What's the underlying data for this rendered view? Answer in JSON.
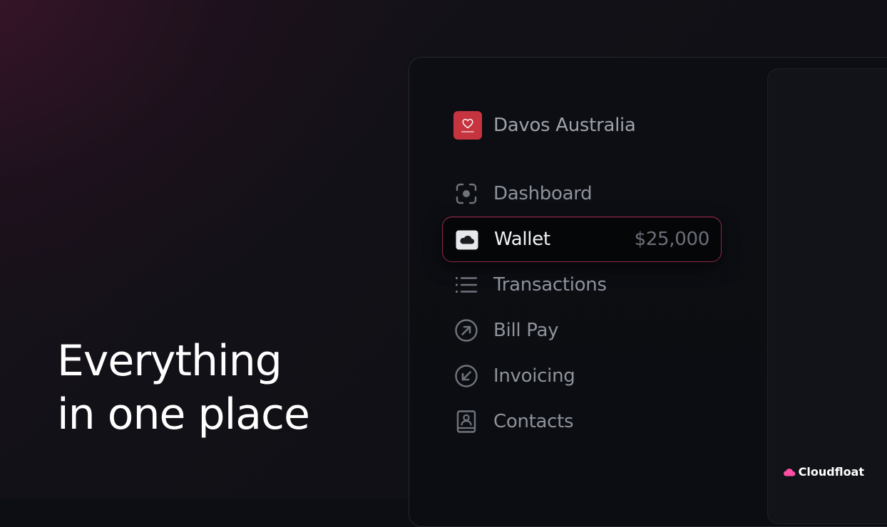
{
  "headline": {
    "line1": "Everything",
    "line2": "in one place"
  },
  "org": {
    "name": "Davos Australia",
    "logo_color": "#c5343f"
  },
  "nav": {
    "items": [
      {
        "label": "Dashboard",
        "icon": "dashboard-focus-icon",
        "active": false
      },
      {
        "label": "Wallet",
        "icon": "cloud-wallet-icon",
        "active": true,
        "amount": "$25,000"
      },
      {
        "label": "Transactions",
        "icon": "list-icon",
        "active": false
      },
      {
        "label": "Bill Pay",
        "icon": "arrow-up-right-circle-icon",
        "active": false
      },
      {
        "label": "Invoicing",
        "icon": "arrow-down-left-circle-icon",
        "active": false
      },
      {
        "label": "Contacts",
        "icon": "contact-book-icon",
        "active": false
      }
    ]
  },
  "brand": {
    "name": "Cloudfloat",
    "accent": "#ff4fa3"
  },
  "colors": {
    "active_border": "#8b2a4a",
    "background": "#0d0e13"
  }
}
